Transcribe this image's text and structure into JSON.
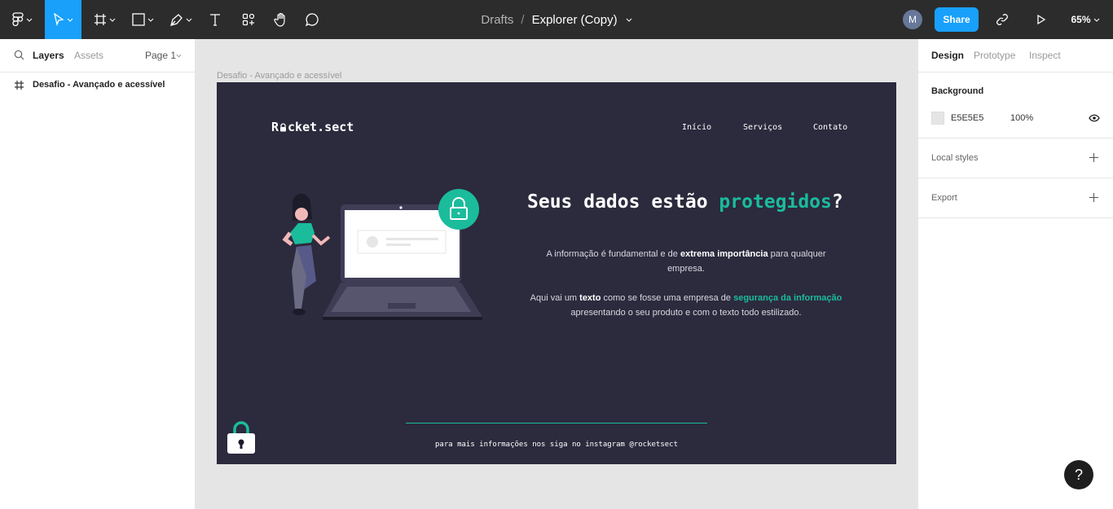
{
  "toolbar": {
    "breadcrumb_project": "Drafts",
    "breadcrumb_sep": "/",
    "file_name": "Explorer (Copy)",
    "avatar_initial": "M",
    "share_label": "Share",
    "zoom": "65%",
    "accent": "#18a0fb"
  },
  "left_panel": {
    "tab_layers": "Layers",
    "tab_assets": "Assets",
    "page": "Page 1",
    "layers": [
      {
        "icon": "frame-icon",
        "label": "Desafio - Avançado e acessível"
      }
    ]
  },
  "canvas": {
    "frame_label": "Desafio - Avançado e acessível",
    "background": "#e5e5e5"
  },
  "design": {
    "logo_prefix": "R",
    "logo_suffix": "cket.sect",
    "nav": [
      "Início",
      "Serviços",
      "Contato"
    ],
    "headline_start": "Seus dados estão ",
    "headline_highlight": "protegidos",
    "headline_end": "?",
    "p1_a": "A informação é fundamental e de ",
    "p1_b": "extrema importância",
    "p1_c": " para qualquer",
    "p1_d": "empresa.",
    "p2_a": "Aqui vai um ",
    "p2_b": "texto",
    "p2_c": " como se fosse uma empresa de ",
    "p2_d": "segurança da informação",
    "p2_e": "apresentando o seu produto e com o texto todo estilizado.",
    "footer": "para mais informações nos siga no instagram @rocketsect",
    "bg_color": "#2c2a3d",
    "accent_color": "#1abc9c"
  },
  "right_panel": {
    "tab_design": "Design",
    "tab_prototype": "Prototype",
    "tab_inspect": "Inspect",
    "background_title": "Background",
    "bg_hex": "E5E5E5",
    "bg_opacity": "100%",
    "local_styles": "Local styles",
    "export": "Export"
  },
  "help_label": "?"
}
